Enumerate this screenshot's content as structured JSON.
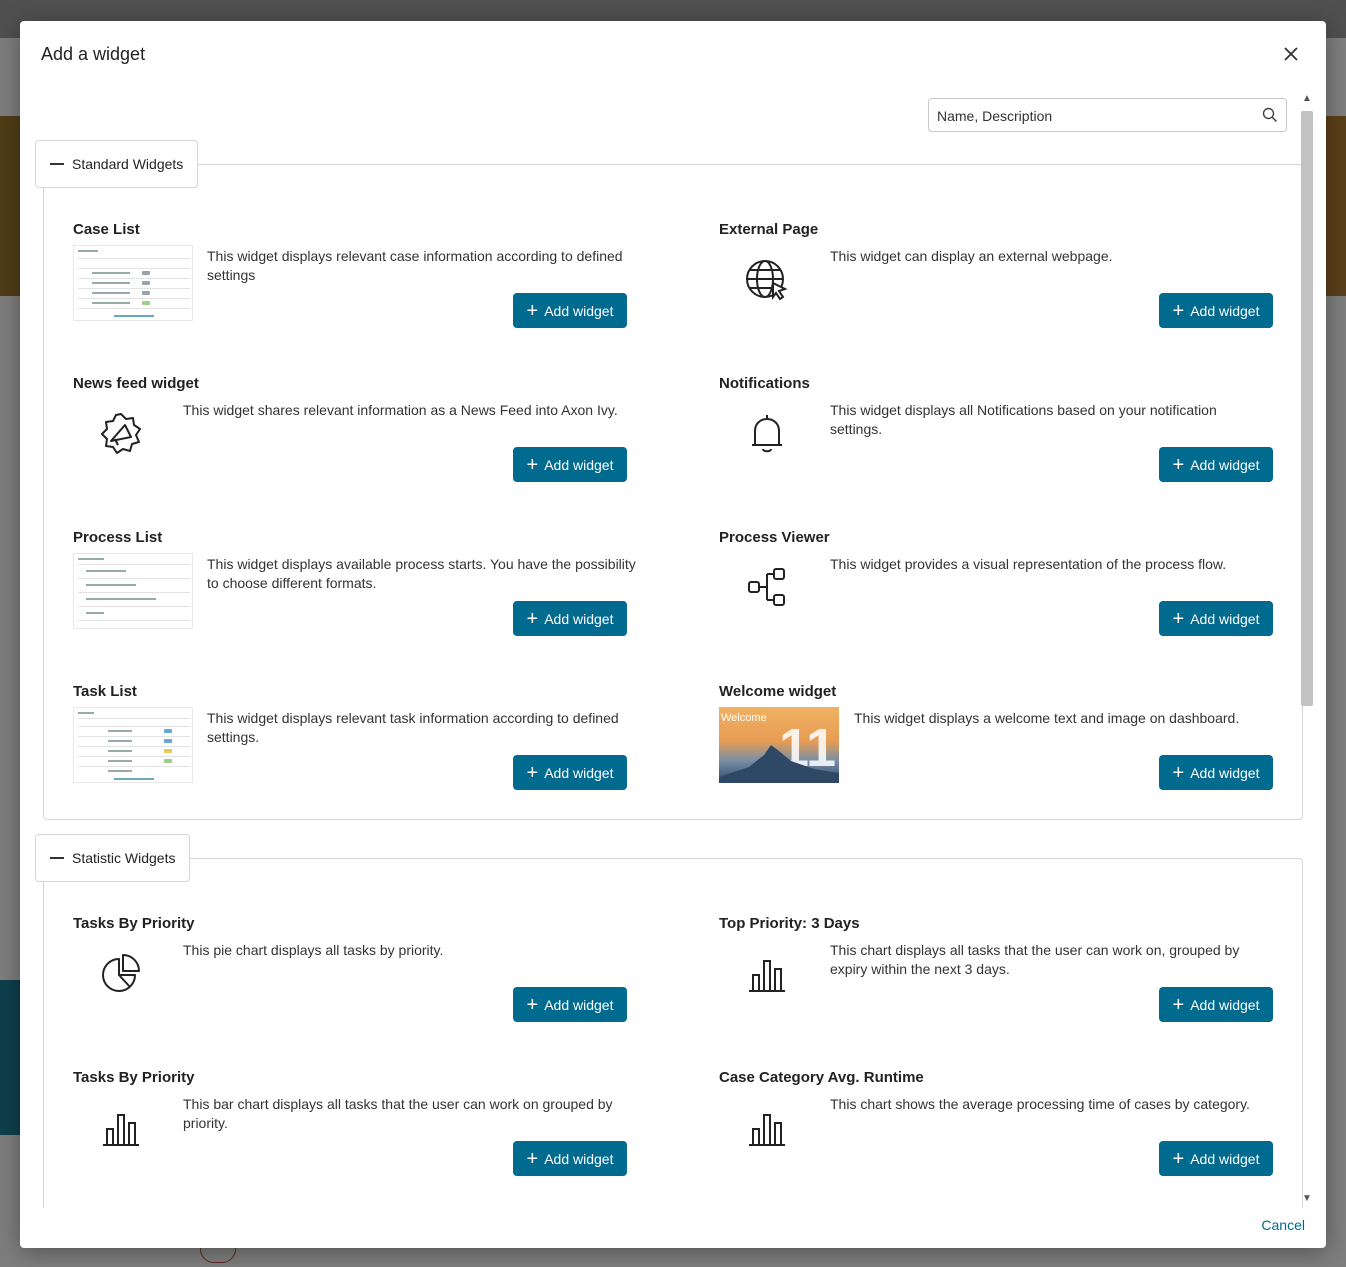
{
  "dialog": {
    "title": "Add a widget",
    "search_placeholder": "Name, Description",
    "cancel_label": "Cancel"
  },
  "sections": {
    "standard": {
      "label": "Standard Widgets",
      "widgets": [
        {
          "title": "Case List",
          "description": "This widget displays relevant case information according to defined settings",
          "button": "Add widget",
          "visual": "case-list-thumbnail"
        },
        {
          "title": "External Page",
          "description": "This widget can display an external webpage.",
          "button": "Add widget",
          "visual": "globe-cursor-icon"
        },
        {
          "title": "News feed widget",
          "description": "This widget shares relevant information as a News Feed into Axon Ivy.",
          "button": "Add widget",
          "visual": "megaphone-icon"
        },
        {
          "title": "Notifications",
          "description": "This widget displays all Notifications based on your notification settings.",
          "button": "Add widget",
          "visual": "bell-icon"
        },
        {
          "title": "Process List",
          "description": "This widget displays available process starts. You have the possibility to choose different formats.",
          "button": "Add widget",
          "visual": "process-list-thumbnail"
        },
        {
          "title": "Process Viewer",
          "description": "This widget provides a visual representation of the process flow.",
          "button": "Add widget",
          "visual": "process-flow-icon"
        },
        {
          "title": "Task List",
          "description": "This widget displays relevant task information according to defined settings.",
          "button": "Add widget",
          "visual": "task-list-thumbnail"
        },
        {
          "title": "Welcome widget",
          "description": "This widget displays a welcome text and image on dashboard.",
          "button": "Add widget",
          "visual": "welcome-thumbnail",
          "thumb_text": "Welcome",
          "thumb_number": "11"
        }
      ]
    },
    "statistic": {
      "label": "Statistic Widgets",
      "widgets": [
        {
          "title": "Tasks By Priority",
          "description": "This pie chart displays all tasks by priority.",
          "button": "Add widget",
          "visual": "pie-chart-icon"
        },
        {
          "title": "Top Priority: 3 Days",
          "description": "This chart displays all tasks that the user can work on, grouped by expiry within the next 3 days.",
          "button": "Add widget",
          "visual": "bar-chart-icon"
        },
        {
          "title": "Tasks By Priority",
          "description": "This bar chart displays all tasks that the user can work on grouped by priority.",
          "button": "Add widget",
          "visual": "bar-chart-icon"
        },
        {
          "title": "Case Category Avg. Runtime",
          "description": "This chart shows the average processing time of cases by category.",
          "button": "Add widget",
          "visual": "bar-chart-icon"
        }
      ]
    }
  },
  "colors": {
    "primary": "#016a8f",
    "border": "#d5d5d5",
    "text": "#222222"
  }
}
